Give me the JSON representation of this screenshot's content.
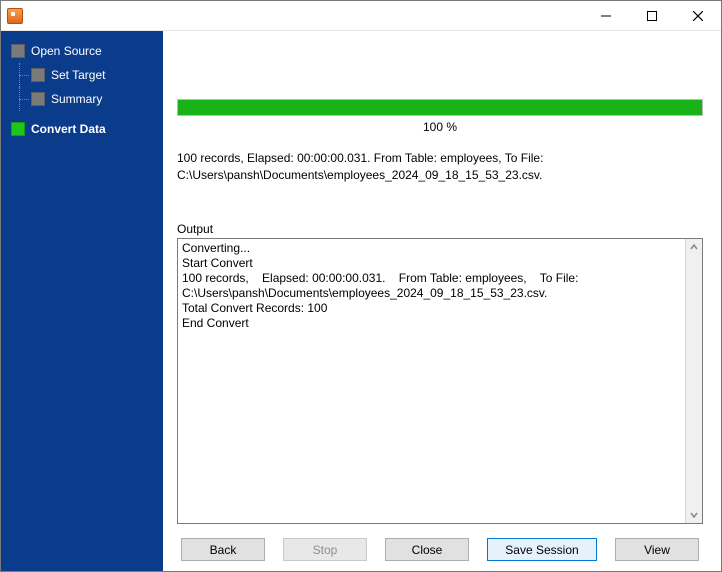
{
  "window": {
    "title": ""
  },
  "sidebar": {
    "root": {
      "label": "Open Source"
    },
    "children": [
      {
        "label": "Set Target"
      },
      {
        "label": "Summary"
      }
    ],
    "current": {
      "label": "Convert Data"
    }
  },
  "progress": {
    "percent_text": "100 %",
    "fill_pct": "100%"
  },
  "status_line": "100 records,    Elapsed: 00:00:00.031.    From Table: employees,    To File: C:\\Users\\pansh\\Documents\\employees_2024_09_18_15_53_23.csv.",
  "output_label": "Output",
  "output_text": "Converting...\nStart Convert\n100 records,    Elapsed: 00:00:00.031.    From Table: employees,    To File: C:\\Users\\pansh\\Documents\\employees_2024_09_18_15_53_23.csv.\nTotal Convert Records: 100\nEnd Convert",
  "buttons": {
    "back": "Back",
    "stop": "Stop",
    "close": "Close",
    "save_session": "Save Session",
    "view": "View"
  }
}
